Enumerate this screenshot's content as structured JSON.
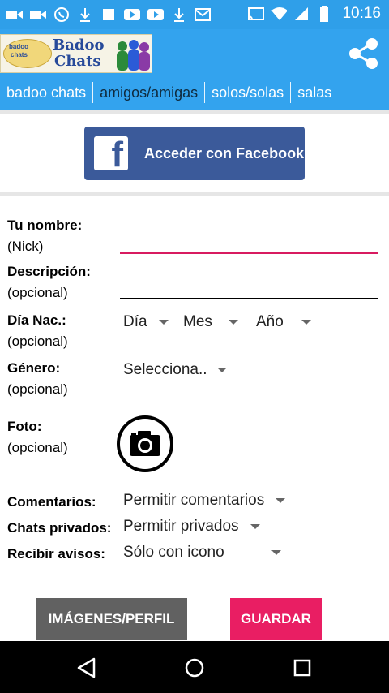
{
  "status_bar": {
    "time": "10:16",
    "icons": [
      "video-icon",
      "video-icon",
      "whatsapp-icon",
      "download-icon",
      "square-icon",
      "youtube-icon",
      "youtube-icon",
      "download-icon",
      "gmail-icon",
      "cast-icon",
      "wifi-icon",
      "signal-icon",
      "battery-icon"
    ]
  },
  "app": {
    "logo_title_1": "Badoo",
    "logo_title_2": "Chats",
    "logo_small_1": "badoo",
    "logo_small_2": "chats"
  },
  "tabs": [
    {
      "label": "badoo chats"
    },
    {
      "label": "amigos/amigas",
      "active": true
    },
    {
      "label": "solos/solas"
    },
    {
      "label": "salas"
    }
  ],
  "facebook": {
    "label": "Acceder con Facebook",
    "icon": "facebook-icon"
  },
  "form": {
    "nombre": {
      "label": "Tu nombre:",
      "sub": "(Nick)",
      "value": ""
    },
    "descripcion": {
      "label": "Descripción:",
      "sub": "(opcional)",
      "value": ""
    },
    "dia_nac": {
      "label": "Día Nac.:",
      "sub": "(opcional)",
      "dia": "Día",
      "mes": "Mes",
      "anio": "Año"
    },
    "genero": {
      "label": "Género:",
      "sub": "(opcional)",
      "value": "Selecciona.."
    },
    "foto": {
      "label": "Foto:",
      "sub": "(opcional)",
      "icon": "camera-icon"
    },
    "comentarios": {
      "label": "Comentarios:",
      "value": "Permitir comentarios"
    },
    "privados": {
      "label": "Chats privados:",
      "value": "Permitir privados"
    },
    "avisos": {
      "label": "Recibir avisos:",
      "value": "Sólo con icono"
    }
  },
  "buttons": {
    "imagenes": "IMÁGENES/PERFIL",
    "guardar": "GUARDAR"
  },
  "colors": {
    "primary": "#33a3ee",
    "accent": "#e91e63",
    "facebook": "#3b5a9a",
    "gray_button": "#616161"
  }
}
